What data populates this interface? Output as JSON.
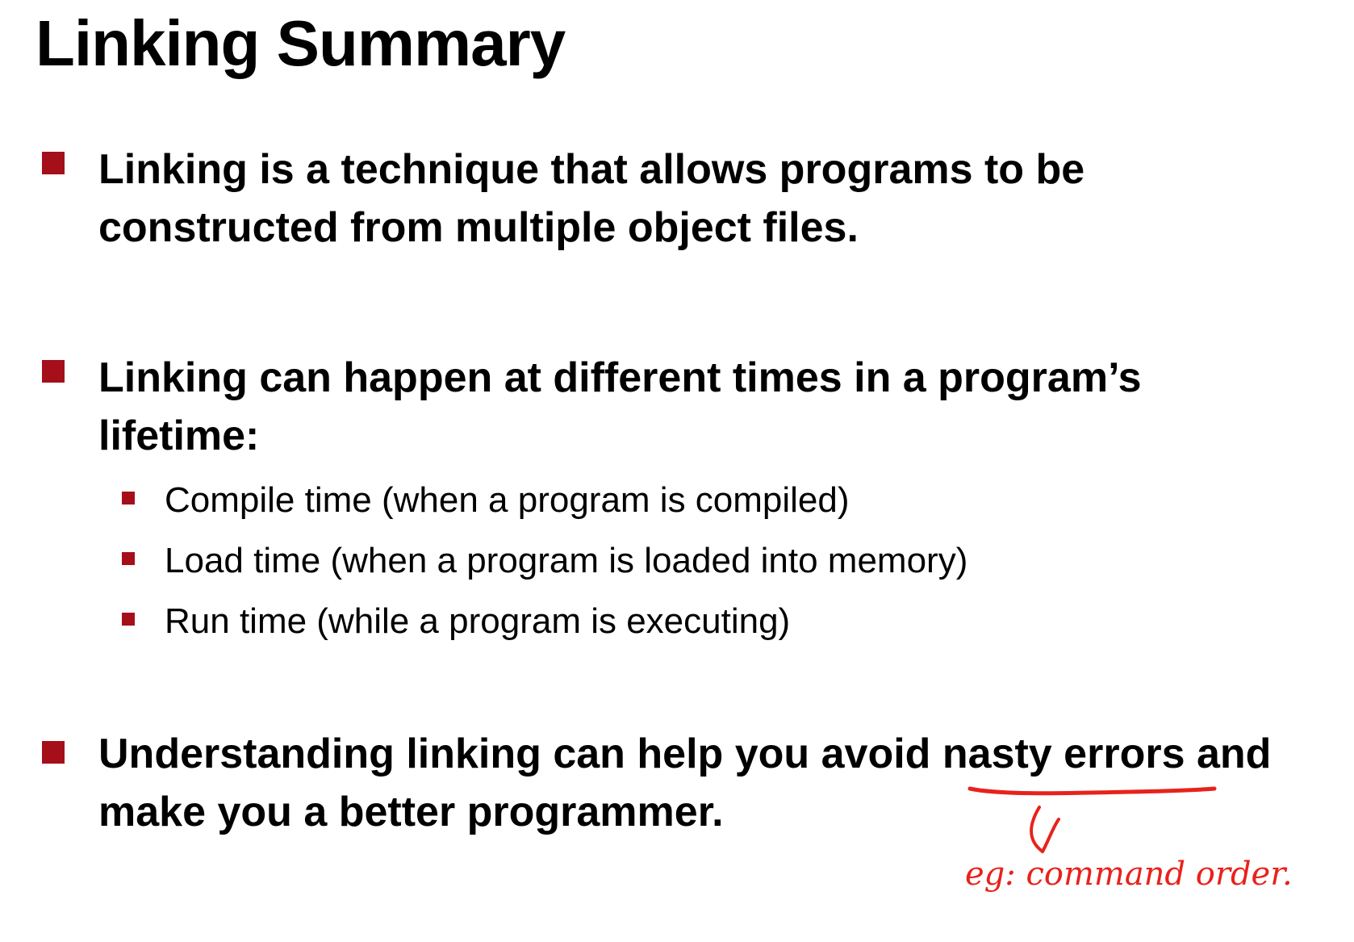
{
  "slide": {
    "title": "Linking Summary",
    "bullets": [
      {
        "lines": [
          "Linking is a technique that allows programs to be",
          "constructed from multiple object files."
        ]
      },
      {
        "lines": [
          "Linking can happen at different times in a program’s",
          "lifetime:"
        ],
        "sub_items": [
          "Compile time (when a program is compiled)",
          "Load time (when a program is loaded into memory)",
          "Run time (while a program is executing)"
        ]
      },
      {
        "lines": [
          "Understanding linking can help you avoid nasty errors and",
          "make you a better programmer."
        ]
      }
    ],
    "annotation": {
      "text": "eg: command order."
    }
  },
  "colors": {
    "bullet": "#a50f1a",
    "text": "#000000",
    "annotation": "#e8221b"
  }
}
